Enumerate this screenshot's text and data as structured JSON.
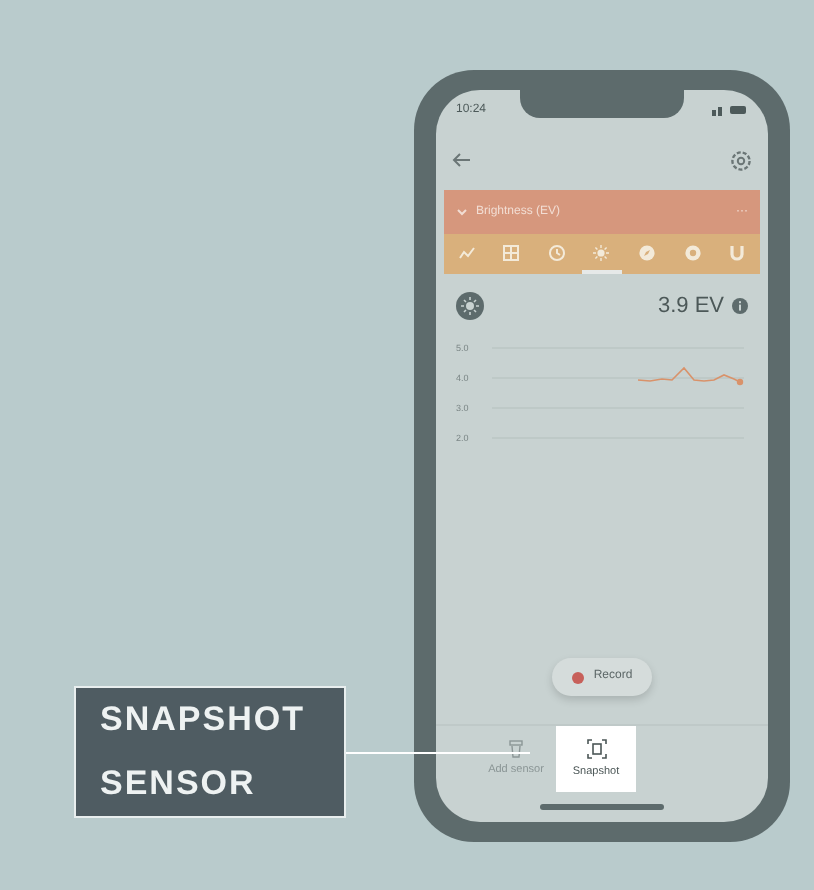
{
  "status_bar": {
    "time": "10:24"
  },
  "sensor_header": {
    "title": "Brightness (EV)",
    "expanded": true,
    "more": "···"
  },
  "sensor_tabs": [
    {
      "kind": "graph",
      "selected": false
    },
    {
      "kind": "grid",
      "selected": false
    },
    {
      "kind": "clock",
      "selected": false
    },
    {
      "kind": "sun",
      "selected": true
    },
    {
      "kind": "compass",
      "selected": false
    },
    {
      "kind": "ring",
      "selected": false
    },
    {
      "kind": "magnet",
      "selected": false
    }
  ],
  "reading": {
    "value": "3.9 EV"
  },
  "chart": {
    "y_labels": [
      "5.0",
      "4.0",
      "3.0",
      "2.0"
    ]
  },
  "record_button": {
    "label": "Record"
  },
  "bottom_nav": [
    {
      "label": "Add sensor",
      "selected": false
    },
    {
      "label": "Snapshot",
      "selected": true
    }
  ],
  "callout": {
    "text": "SNAPSHOT SENSOR"
  }
}
